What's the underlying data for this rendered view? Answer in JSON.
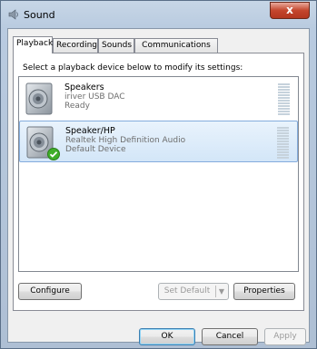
{
  "window": {
    "title": "Sound",
    "close_glyph": "x"
  },
  "tabs": [
    {
      "label": "Playback",
      "active": true
    },
    {
      "label": "Recording",
      "active": false
    },
    {
      "label": "Sounds",
      "active": false
    },
    {
      "label": "Communications",
      "active": false
    }
  ],
  "instruction": "Select a playback device below to modify its settings:",
  "devices": [
    {
      "name": "Speakers",
      "line1": "iriver USB DAC",
      "line2": "Ready",
      "selected": false,
      "icon": "speaker-icon"
    },
    {
      "name": "Speaker/HP",
      "line1": "Realtek High Definition Audio",
      "line2": "Default Device",
      "selected": true,
      "icon": "speaker-icon",
      "badge": "default-checkmark-icon"
    }
  ],
  "buttons": {
    "configure": "Configure",
    "set_default": "Set Default",
    "properties": "Properties",
    "ok": "OK",
    "cancel": "Cancel",
    "apply": "Apply"
  },
  "colors": {
    "selection": "#d3e6f8",
    "check_green": "#3fae29",
    "close_red": "#c4462d"
  }
}
